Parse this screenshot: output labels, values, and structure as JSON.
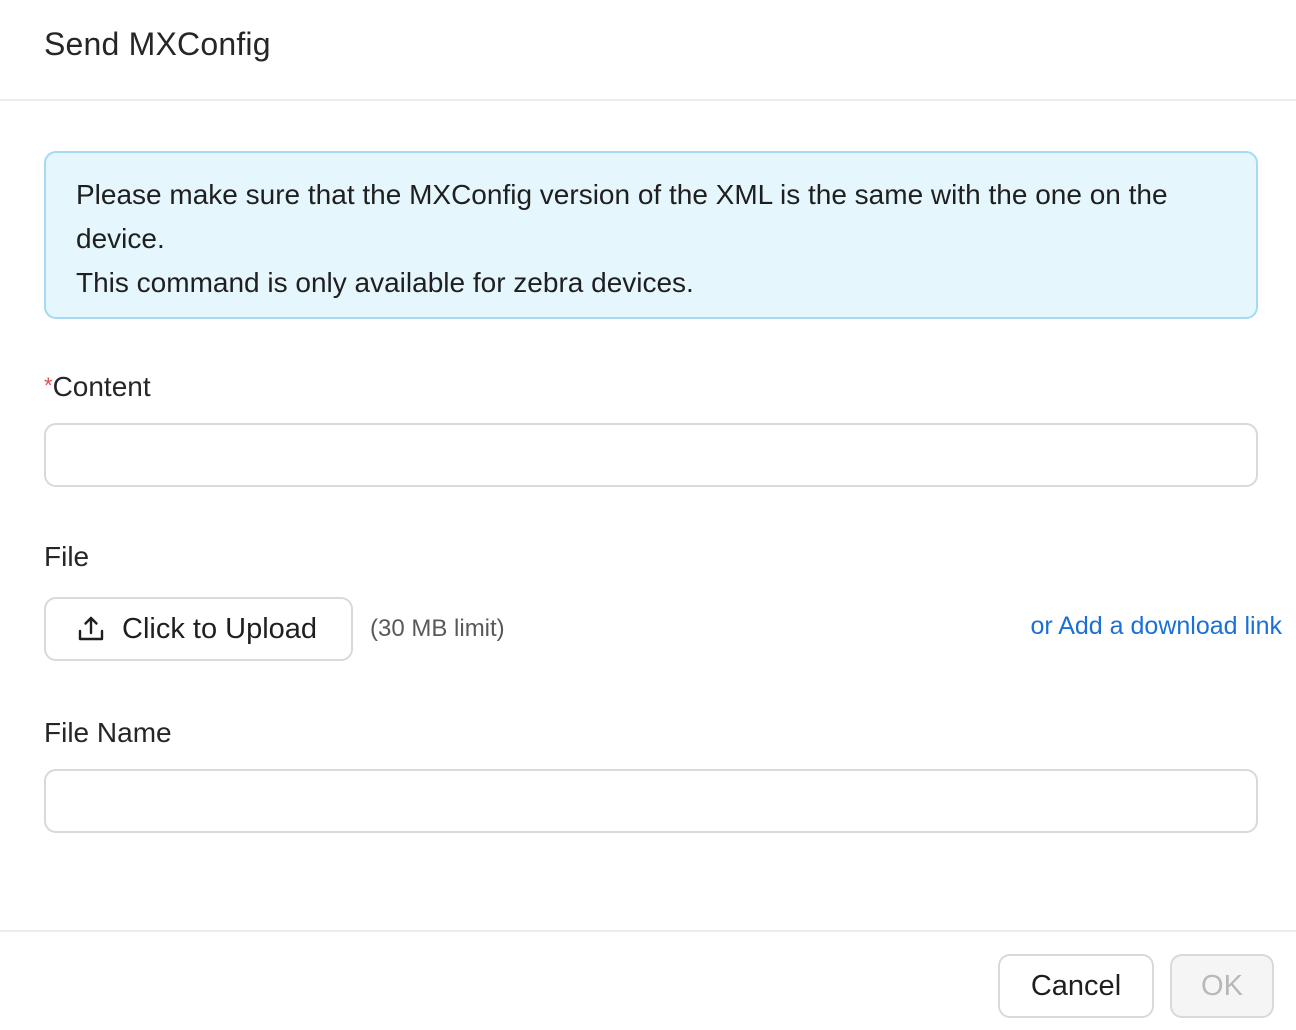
{
  "dialog": {
    "title": "Send MXConfig"
  },
  "alert": {
    "line1": "Please make sure that the MXConfig version of the XML is the same with the one on the device.",
    "line2": "This command is only available for zebra devices."
  },
  "fields": {
    "content": {
      "required_mark": "*",
      "label": "Content",
      "value": "",
      "placeholder": ""
    },
    "file": {
      "label": "File",
      "upload_label": "Click to Upload",
      "upload_icon": "upload-icon",
      "limit": "(30 MB limit)",
      "download_link_label": "or Add a download link"
    },
    "file_name": {
      "label": "File Name",
      "value": "",
      "placeholder": ""
    }
  },
  "footer": {
    "cancel_label": "Cancel",
    "ok_label": "OK"
  },
  "colors": {
    "alert_bg": "#e5f6fd",
    "alert_border": "#a3daf4",
    "link": "#1a6fd8",
    "required": "#e5484d"
  }
}
